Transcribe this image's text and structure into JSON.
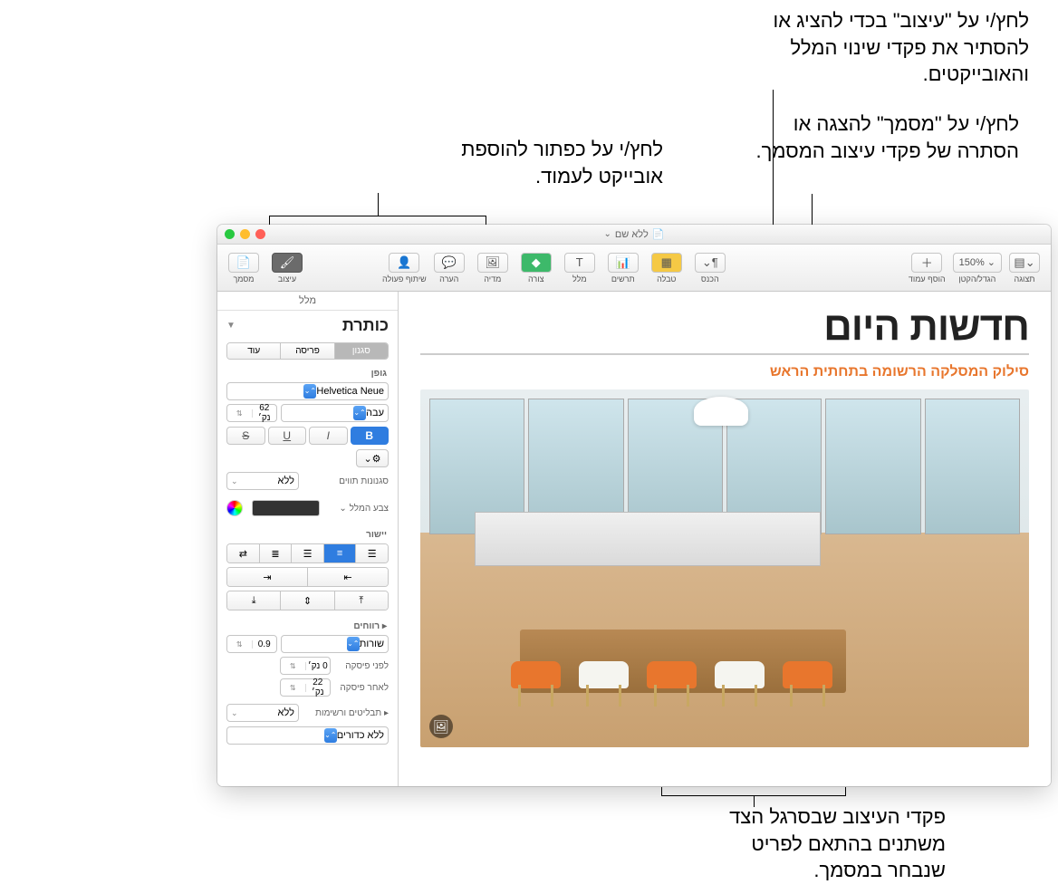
{
  "callouts": {
    "format": "לחץ/י על \"עיצוב\" בכדי להציג או להסתיר את פקדי שינוי המלל והאובייקטים.",
    "document": "לחץ/י על \"מסמך\" להצגה או הסתרה של פקדי עיצוב המסמך.",
    "add_object": "לחץ/י על כפתור להוספת אובייקט לעמוד.",
    "sidebar": "פקדי העיצוב שבסרגל הצד משתנים בהתאם לפריט שנבחר במסמך."
  },
  "titlebar": {
    "title": "ללא שם",
    "edited": ""
  },
  "toolbar": {
    "view": "תצוגה",
    "zoom": "הגדל/הקטן",
    "zoom_value": "150%",
    "add_page": "הוסף עמוד",
    "insert": "הכנס",
    "table": "טבלה",
    "chart": "תרשים",
    "text": "מלל",
    "shape": "צורה",
    "media": "מדיה",
    "comment": "הערה",
    "collab": "שיתוף פעולה",
    "format": "עיצוב",
    "document": "מסמך"
  },
  "sidebar": {
    "tab": "מלל",
    "title": "כותרת",
    "tabs": {
      "style": "סגנון",
      "layout": "פריסה",
      "more": "עוד"
    },
    "font_label": "גופן",
    "font_family": "Helvetica Neue",
    "font_weight": "עבה",
    "font_size": "62 נק׳",
    "char_styles": "סגנונות תווים",
    "char_styles_val": "ללא",
    "text_color": "צבע המלל",
    "alignment": "יישור",
    "spacing_label": "רווחים",
    "line_spacing": "שורות",
    "line_spacing_val": "0.9",
    "before_para": "לפני פיסקה",
    "before_para_val": "0 נק׳",
    "after_para": "לאחר פיסקה",
    "after_para_val": "22 נק׳",
    "bullets": "תבליטים ורשימות",
    "bullets_val": "ללא",
    "bullets_style": "ללא כדורים"
  },
  "document": {
    "title": "חדשות היום",
    "subtitle": "סילוק המסלקה הרשומה בתחתית הראש"
  }
}
